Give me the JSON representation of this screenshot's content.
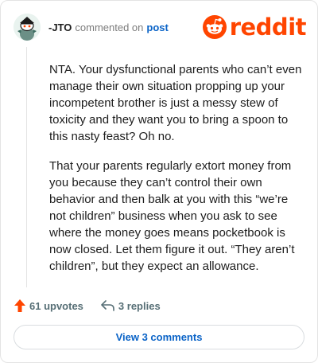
{
  "comment": {
    "username": "-JTO",
    "action_text": "commented on",
    "post_link": "post",
    "paragraphs": [
      "NTA. Your dysfunctional parents who can’t even manage their own situation propping up your incompetent brother is just a messy stew of toxicity and they want you to bring a spoon to this nasty feast? Oh no.",
      "That your parents regularly extort money from you because they can’t control their own behavior and then balk at you with this “we’re not children” business when you ask to see where the money goes means pocketbook is now closed. Let them figure it out. “They aren’t children”, but they expect an allowance."
    ]
  },
  "brand": {
    "wordmark": "reddit",
    "color": "#ff4500"
  },
  "actions": {
    "upvotes_label": "61 upvotes",
    "replies_label": "3 replies"
  },
  "footer": {
    "view_comments_label": "View 3 comments"
  },
  "colors": {
    "accent": "#0a63c7",
    "upvote": "#ff4500",
    "muted": "#576f76"
  },
  "icons": [
    "avatar-snoo",
    "reddit-alien-icon",
    "upvote-arrow-icon",
    "reply-icon"
  ]
}
